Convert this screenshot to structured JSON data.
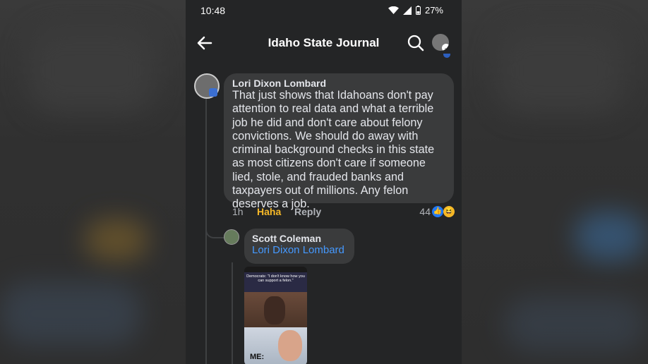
{
  "status_bar": {
    "time": "10:48",
    "battery": "27%"
  },
  "header": {
    "title": "Idaho State Journal"
  },
  "comment": {
    "author": "Lori Dixon Lombard",
    "text": "That just shows that Idahoans don't pay attention to real data and what a terrible job he did and don't care about felony convictions.  We should do away with criminal background checks in this state as most citizens don't care if someone lied, stole, and frauded banks and taxpayers out of millions.  Any felon deserves a job.",
    "time": "1h",
    "haha_label": "Haha",
    "reply_label": "Reply",
    "reaction_count": "44"
  },
  "reply": {
    "author": "Scott Coleman",
    "mention": "Lori Dixon Lombard",
    "meme_caption": "Democrats: \"I don't know how you can support a felon.\"",
    "meme_label": "ME:"
  },
  "colors": {
    "accent": "#4599ff",
    "haha": "#f7b928",
    "like": "#2078f4"
  }
}
